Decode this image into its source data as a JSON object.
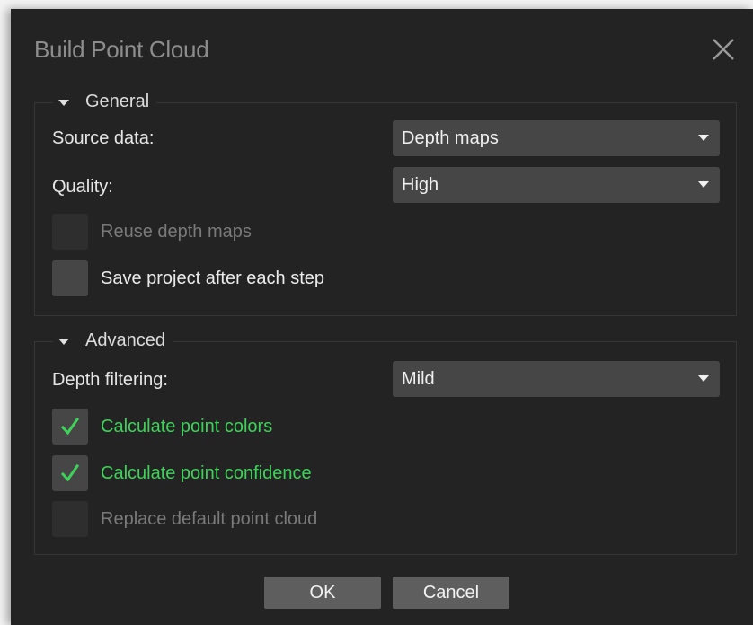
{
  "dialog": {
    "title": "Build Point Cloud",
    "close_icon": "close-icon"
  },
  "general": {
    "legend": "General",
    "source_data": {
      "label": "Source data:",
      "value": "Depth maps"
    },
    "quality": {
      "label": "Quality:",
      "value": "High"
    },
    "reuse_depth_maps": {
      "label": "Reuse depth maps",
      "checked": false,
      "enabled": false
    },
    "save_project": {
      "label": "Save project after each step",
      "checked": false,
      "enabled": true
    }
  },
  "advanced": {
    "legend": "Advanced",
    "depth_filtering": {
      "label": "Depth filtering:",
      "value": "Mild"
    },
    "calc_colors": {
      "label": "Calculate point colors",
      "checked": true,
      "enabled": true
    },
    "calc_confidence": {
      "label": "Calculate point confidence",
      "checked": true,
      "enabled": true
    },
    "replace_default": {
      "label": "Replace default point cloud",
      "checked": false,
      "enabled": false
    }
  },
  "buttons": {
    "ok": "OK",
    "cancel": "Cancel"
  },
  "colors": {
    "background": "#232323",
    "control": "#464646",
    "checked_text": "#3fd25a",
    "button": "#5e5e5e"
  }
}
